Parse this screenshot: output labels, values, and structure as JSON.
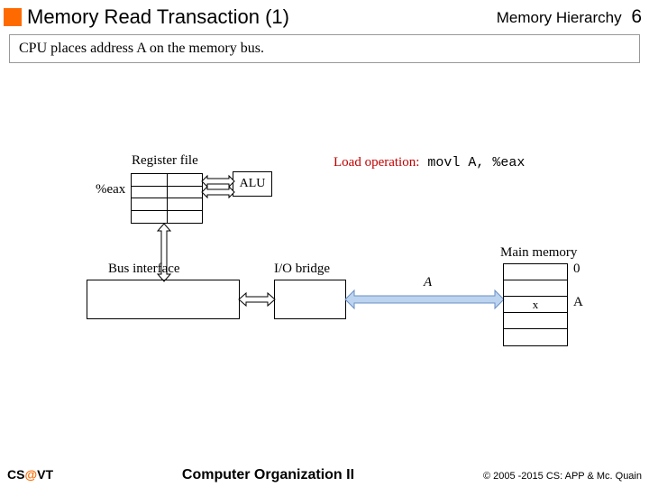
{
  "header": {
    "title": "Memory Read Transaction (1)",
    "section": "Memory Hierarchy",
    "page_num": "6"
  },
  "subtitle": "CPU places address A on the memory bus.",
  "labels": {
    "register_file": "Register file",
    "eax": "%eax",
    "alu": "ALU",
    "load_prefix": "Load operation:",
    "load_code": " movl A, %eax",
    "io_bridge": "I/O bridge",
    "bus_interface": "Bus interface",
    "bus_a": "A",
    "main_memory": "Main memory",
    "mem_0": "0",
    "mem_x": "x",
    "mem_A": "A"
  },
  "footer": {
    "left_cs": "CS",
    "left_at": "@",
    "left_vt": "VT",
    "mid": "Computer Organization II",
    "right": "© 2005 -2015 CS: APP & Mc. Quain"
  }
}
